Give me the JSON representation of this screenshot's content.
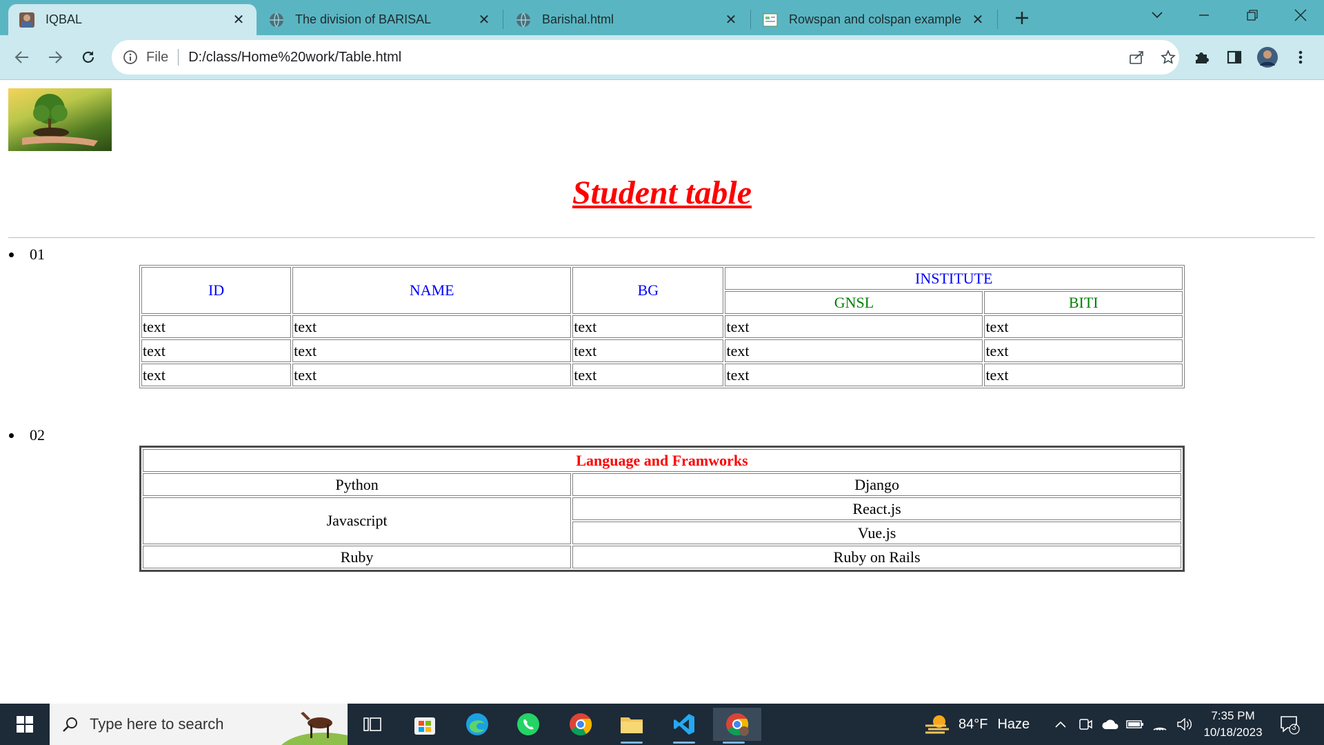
{
  "browser": {
    "tabs": [
      {
        "title": "IQBAL",
        "active": true,
        "icon": "profile-photo-favicon"
      },
      {
        "title": "The division of BARISAL",
        "active": false,
        "icon": "globe-favicon"
      },
      {
        "title": "Barishal.html",
        "active": false,
        "icon": "globe-favicon"
      },
      {
        "title": "Rowspan and colspan example",
        "active": false,
        "icon": "image-favicon"
      }
    ],
    "scheme": "File",
    "url": "D:/class/Home%20work/Table.html"
  },
  "page": {
    "title": "Student table",
    "list": [
      {
        "marker": "01"
      },
      {
        "marker": "02"
      }
    ],
    "table1": {
      "headers": {
        "id": "ID",
        "name": "NAME",
        "bg": "BG",
        "institute": "INSTITUTE",
        "sub1": "GNSL",
        "sub2": "BITI"
      },
      "rows": [
        [
          "text",
          "text",
          "text",
          "text",
          "text"
        ],
        [
          "text",
          "text",
          "text",
          "text",
          "text"
        ],
        [
          "text",
          "text",
          "text",
          "text",
          "text"
        ]
      ]
    },
    "table2": {
      "caption": "Language and Framworks",
      "python": "Python",
      "django": "Django",
      "javascript": "Javascript",
      "react": "React.js",
      "vue": "Vue.js",
      "ruby": "Ruby",
      "rails": "Ruby on Rails"
    }
  },
  "taskbar": {
    "search_placeholder": "Type here to search",
    "weather_temp": "84°F",
    "weather_desc": "Haze",
    "time": "7:35 PM",
    "date": "10/18/2023",
    "notification_count": "3"
  }
}
